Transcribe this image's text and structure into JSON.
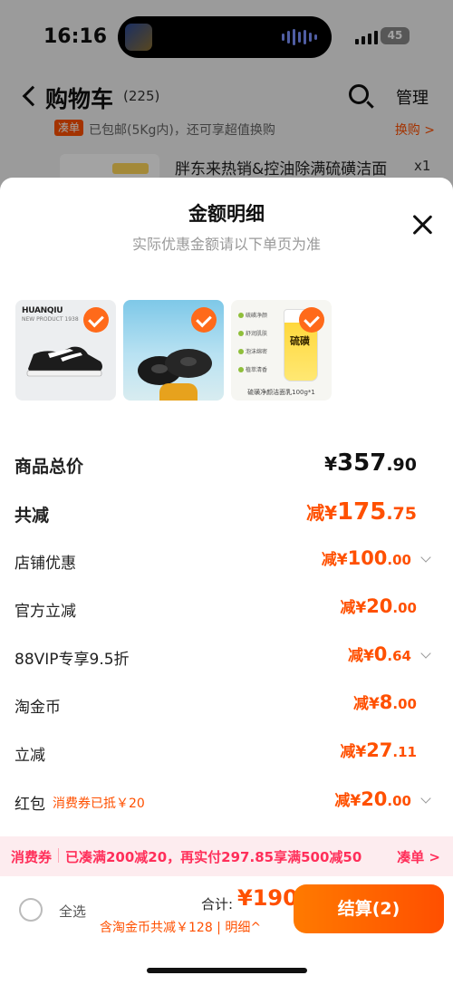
{
  "status_bar": {
    "time": "16:16",
    "battery": "45"
  },
  "nav": {
    "title": "购物车",
    "count": "(225)",
    "manage": "管理"
  },
  "promo": {
    "badge": "凑单",
    "text": "已包邮(5Kg内)，还可享超值换购",
    "link": "换购 >"
  },
  "bg_product": {
    "title": "胖东来热销&控油除满硫磺洁面",
    "qty": "x1"
  },
  "sheet": {
    "title": "金额明细",
    "subtitle": "实际优惠金额请以下单页为准",
    "thumbs": [
      {
        "brand": "HUANQIU",
        "brand_sub": "NEW PRODUCT 1938"
      },
      {
        "brand": ""
      },
      {
        "features": [
          "硫磺净颜",
          "舒润肌肤",
          "泡沫绵密",
          "植萃清香"
        ],
        "tube_label": "硫磺",
        "caption": "硫磺净颜洁面乳100g*1"
      }
    ]
  },
  "breakdown": [
    {
      "label": "商品总价",
      "prefix": "¥",
      "int": "357",
      "dec": ".90"
    },
    {
      "label": "共减",
      "prefix": "减¥",
      "int": "175",
      "dec": ".75"
    },
    {
      "label": "店铺优惠",
      "prefix": "减¥",
      "int": "100",
      "dec": ".00"
    },
    {
      "label": "官方立减",
      "prefix": "减¥",
      "int": "20",
      "dec": ".00"
    },
    {
      "label": "88VIP专享9.5折",
      "prefix": "减¥",
      "int": "0",
      "dec": ".64"
    },
    {
      "label": "淘金币",
      "prefix": "减¥",
      "int": "8",
      "dec": ".00"
    },
    {
      "label": "立减",
      "prefix": "减¥",
      "int": "27",
      "dec": ".11"
    },
    {
      "label": "红包",
      "note": "消费券已抵￥20",
      "prefix": "减¥",
      "int": "20",
      "dec": ".00"
    }
  ],
  "coupon_bar": {
    "label": "消费券",
    "text": "已凑满200减20，再实付297.85享满500减50",
    "link": "凑单 >"
  },
  "footer": {
    "select_all": "全选",
    "sum_label": "合计:",
    "sum_value": "¥190",
    "sum_sub": "含淘金币共减￥128 | 明细^",
    "checkout": "结算(2)"
  },
  "colors": {
    "accent": "#ff5000",
    "coupon": "#ff2f5a"
  }
}
